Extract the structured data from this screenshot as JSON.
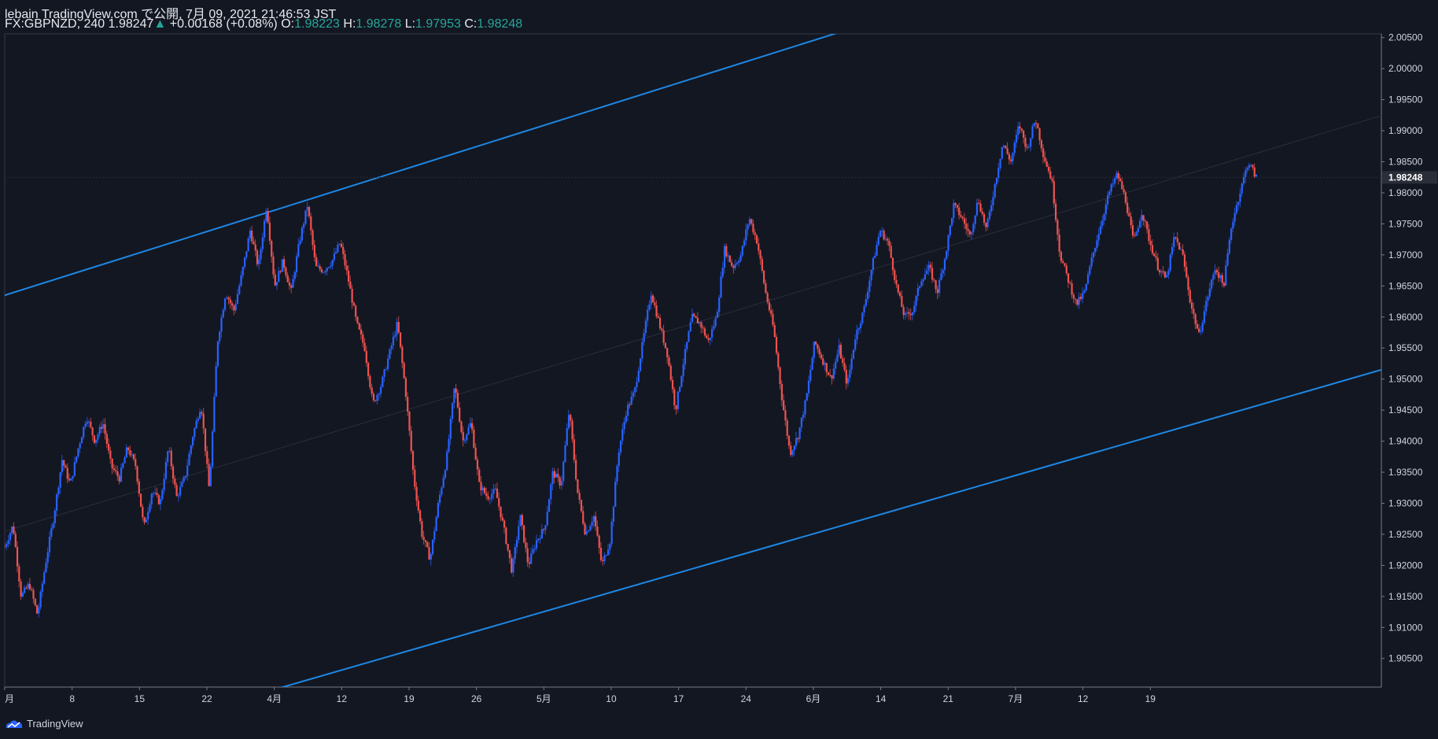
{
  "header": {
    "line1": "lebain TradingView.com で公開, 7月 09, 2021 21:46:53 JST",
    "symbol": "FX:GBPNZD, 240",
    "last": "1.98247",
    "arrow": "▲",
    "change": "+0.00168 (+0.08%)",
    "o_label": "O:",
    "o_value": "1.98223",
    "h_label": "H:",
    "h_value": "1.98278",
    "l_label": "L:",
    "l_value": "1.97953",
    "c_label": "C:",
    "c_value": "1.98248"
  },
  "brand": {
    "name": "TradingView"
  },
  "colors": {
    "background": "#131722",
    "up": "#2962ff",
    "down": "#ef5350",
    "channel": "#1e88e5",
    "axis": "#363a45",
    "text": "#d1d4dc",
    "teal": "#26a69a"
  },
  "chart_data": {
    "type": "candlestick",
    "symbol": "FX:GBPNZD",
    "timeframe": "240",
    "x_tick_labels": [
      "月",
      "8",
      "15",
      "22",
      "4月",
      "12",
      "19",
      "26",
      "5月",
      "10",
      "17",
      "24",
      "6月",
      "14",
      "21",
      "7月",
      "12",
      "19"
    ],
    "y_tick_labels": [
      "2.00500",
      "2.00000",
      "1.99500",
      "1.99000",
      "1.98500",
      "1.98000",
      "1.97500",
      "1.97000",
      "1.96500",
      "1.96000",
      "1.95500",
      "1.95000",
      "1.94500",
      "1.94000",
      "1.93500",
      "1.93000",
      "1.92500",
      "1.92000",
      "1.91500",
      "1.91000",
      "1.90500"
    ],
    "last_price_label": "1.98248",
    "y_range": [
      1.9004,
      2.0056
    ],
    "x_range_days": [
      "2021-03-01",
      "2021-07-22"
    ],
    "close_path": [
      [
        0,
        1.923
      ],
      [
        1,
        1.9265
      ],
      [
        2,
        1.915
      ],
      [
        3,
        1.917
      ],
      [
        4,
        1.912
      ],
      [
        5,
        1.9205
      ],
      [
        6,
        1.928
      ],
      [
        7,
        1.937
      ],
      [
        8,
        1.933
      ],
      [
        9,
        1.939
      ],
      [
        10,
        1.944
      ],
      [
        11,
        1.94
      ],
      [
        12,
        1.943
      ],
      [
        13,
        1.936
      ],
      [
        14,
        1.934
      ],
      [
        15,
        1.939
      ],
      [
        16,
        1.936
      ],
      [
        17,
        1.926
      ],
      [
        18,
        1.932
      ],
      [
        19,
        1.93
      ],
      [
        20,
        1.939
      ],
      [
        21,
        1.931
      ],
      [
        22,
        1.934
      ],
      [
        23,
        1.941
      ],
      [
        24,
        1.946
      ],
      [
        25,
        1.932
      ],
      [
        26,
        1.956
      ],
      [
        27,
        1.964
      ],
      [
        28,
        1.961
      ],
      [
        29,
        1.967
      ],
      [
        30,
        1.974
      ],
      [
        31,
        1.968
      ],
      [
        32,
        1.978
      ],
      [
        33,
        1.965
      ],
      [
        34,
        1.969
      ],
      [
        35,
        1.964
      ],
      [
        36,
        1.972
      ],
      [
        37,
        1.978
      ],
      [
        38,
        1.968
      ],
      [
        39,
        1.9675
      ],
      [
        40,
        1.969
      ],
      [
        41,
        1.972
      ],
      [
        42,
        1.966
      ],
      [
        43,
        1.959
      ],
      [
        44,
        1.955
      ],
      [
        45,
        1.946
      ],
      [
        46,
        1.949
      ],
      [
        47,
        1.954
      ],
      [
        48,
        1.959
      ],
      [
        49,
        1.948
      ],
      [
        50,
        1.934
      ],
      [
        51,
        1.925
      ],
      [
        52,
        1.921
      ],
      [
        53,
        1.93
      ],
      [
        54,
        1.937
      ],
      [
        55,
        1.949
      ],
      [
        56,
        1.94
      ],
      [
        57,
        1.943
      ],
      [
        58,
        1.933
      ],
      [
        59,
        1.931
      ],
      [
        60,
        1.932
      ],
      [
        61,
        1.926
      ],
      [
        62,
        1.919
      ],
      [
        63,
        1.928
      ],
      [
        64,
        1.92
      ],
      [
        65,
        1.924
      ],
      [
        66,
        1.926
      ],
      [
        67,
        1.935
      ],
      [
        68,
        1.933
      ],
      [
        69,
        1.945
      ],
      [
        70,
        1.932
      ],
      [
        71,
        1.925
      ],
      [
        72,
        1.928
      ],
      [
        73,
        1.92
      ],
      [
        74,
        1.924
      ],
      [
        75,
        1.938
      ],
      [
        76,
        1.945
      ],
      [
        77,
        1.948
      ],
      [
        78,
        1.956
      ],
      [
        79,
        1.964
      ],
      [
        80,
        1.959
      ],
      [
        81,
        1.954
      ],
      [
        82,
        1.945
      ],
      [
        83,
        1.953
      ],
      [
        84,
        1.96
      ],
      [
        85,
        1.959
      ],
      [
        86,
        1.956
      ],
      [
        87,
        1.96
      ],
      [
        88,
        1.971
      ],
      [
        89,
        1.968
      ],
      [
        90,
        1.97
      ],
      [
        91,
        1.976
      ],
      [
        92,
        1.972
      ],
      [
        93,
        1.964
      ],
      [
        94,
        1.958
      ],
      [
        95,
        1.947
      ],
      [
        96,
        1.938
      ],
      [
        97,
        1.941
      ],
      [
        98,
        1.947
      ],
      [
        99,
        1.956
      ],
      [
        100,
        1.953
      ],
      [
        101,
        1.95
      ],
      [
        102,
        1.955
      ],
      [
        103,
        1.949
      ],
      [
        104,
        1.957
      ],
      [
        105,
        1.961
      ],
      [
        106,
        1.968
      ],
      [
        107,
        1.974
      ],
      [
        108,
        1.972
      ],
      [
        109,
        1.965
      ],
      [
        110,
        1.96
      ],
      [
        111,
        1.961
      ],
      [
        112,
        1.966
      ],
      [
        113,
        1.968
      ],
      [
        114,
        1.964
      ],
      [
        115,
        1.97
      ],
      [
        116,
        1.978
      ],
      [
        117,
        1.976
      ],
      [
        118,
        1.973
      ],
      [
        119,
        1.979
      ],
      [
        120,
        1.974
      ],
      [
        121,
        1.981
      ],
      [
        122,
        1.988
      ],
      [
        123,
        1.985
      ],
      [
        124,
        1.991
      ],
      [
        125,
        1.987
      ],
      [
        126,
        1.992
      ],
      [
        127,
        1.986
      ],
      [
        128,
        1.982
      ],
      [
        129,
        1.97
      ],
      [
        130,
        1.966
      ],
      [
        131,
        1.962
      ],
      [
        132,
        1.964
      ],
      [
        133,
        1.97
      ],
      [
        134,
        1.975
      ],
      [
        135,
        1.98
      ],
      [
        136,
        1.983
      ],
      [
        137,
        1.979
      ],
      [
        138,
        1.972
      ],
      [
        139,
        1.977
      ],
      [
        140,
        1.972
      ],
      [
        141,
        1.968
      ],
      [
        142,
        1.966
      ],
      [
        143,
        1.973
      ],
      [
        144,
        1.97
      ],
      [
        145,
        1.962
      ],
      [
        146,
        1.957
      ],
      [
        147,
        1.963
      ],
      [
        148,
        1.968
      ],
      [
        149,
        1.965
      ],
      [
        150,
        1.975
      ],
      [
        151,
        1.98
      ],
      [
        152,
        1.985
      ],
      [
        153,
        1.9825
      ]
    ],
    "channel": {
      "upper": {
        "x": [
          "2021-03-01",
          "2021-05-27"
        ],
        "y": [
          1.9635,
          2.006
        ]
      },
      "lower": {
        "x": [
          "2021-03-29",
          "2021-07-22"
        ],
        "y": [
          1.9,
          1.9515
        ]
      }
    },
    "grid": false,
    "legend": "none"
  }
}
